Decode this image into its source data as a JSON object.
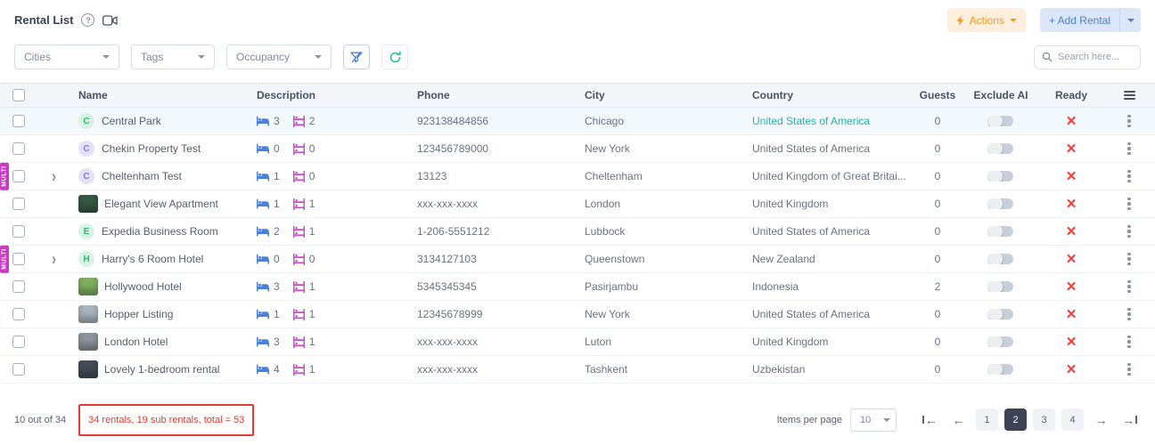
{
  "header": {
    "title": "Rental List",
    "actions_label": "Actions",
    "add_rental_label": "+ Add Rental",
    "accent_orange": "#f29a1e",
    "accent_blue": "#4d80d2"
  },
  "filters": {
    "cities_label": "Cities",
    "tags_label": "Tags",
    "occupancy_label": "Occupancy",
    "search_placeholder": "Search here..."
  },
  "table": {
    "multi_tag_label": "MULTI",
    "expand_glyph": "›",
    "not_ready_glyph": "×",
    "columns": {
      "name": "Name",
      "description": "Description",
      "phone": "Phone",
      "city": "City",
      "country": "Country",
      "guests": "Guests",
      "exclude_ai": "Exclude AI",
      "ready": "Ready"
    },
    "rows": [
      {
        "name": "Central Park",
        "badge": "C",
        "badge_bg": "#d8f3e4",
        "badge_fg": "#2fb57c",
        "thumb": null,
        "multi": false,
        "expandable": false,
        "beds": "3",
        "baths": "2",
        "phone": "923138484856",
        "city": "Chicago",
        "country": "United States of America",
        "country_link": true,
        "guests": "0",
        "exclude_ai": false,
        "ready": false,
        "highlighted": true
      },
      {
        "name": "Chekin Property Test",
        "badge": "C",
        "badge_bg": "#e6e1f9",
        "badge_fg": "#8478d9",
        "thumb": null,
        "multi": false,
        "expandable": false,
        "beds": "0",
        "baths": "0",
        "phone": "123456789000",
        "city": "New York",
        "country": "United States of America",
        "country_link": false,
        "guests": "0",
        "exclude_ai": false,
        "ready": false,
        "highlighted": false
      },
      {
        "name": "Cheltenham Test",
        "badge": "C",
        "badge_bg": "#e6e1f9",
        "badge_fg": "#8478d9",
        "thumb": null,
        "multi": true,
        "expandable": true,
        "beds": "1",
        "baths": "0",
        "phone": "13123",
        "city": "Cheltenham",
        "country": "United Kingdom of Great Britai...",
        "country_link": false,
        "guests": "0",
        "exclude_ai": false,
        "ready": false,
        "highlighted": false
      },
      {
        "name": "Elegant View Apartment",
        "badge": null,
        "badge_bg": null,
        "badge_fg": null,
        "thumb": "#355844",
        "multi": false,
        "expandable": false,
        "beds": "1",
        "baths": "1",
        "phone": "xxx-xxx-xxxx",
        "city": "London",
        "country": "United Kingdom",
        "country_link": false,
        "guests": "0",
        "exclude_ai": false,
        "ready": false,
        "highlighted": false
      },
      {
        "name": "Expedia Business Room",
        "badge": "E",
        "badge_bg": "#d8f3e4",
        "badge_fg": "#2fb57c",
        "thumb": null,
        "multi": false,
        "expandable": false,
        "beds": "2",
        "baths": "1",
        "phone": "1-206-5551212",
        "city": "Lubbock",
        "country": "United States of America",
        "country_link": false,
        "guests": "0",
        "exclude_ai": false,
        "ready": false,
        "highlighted": false
      },
      {
        "name": "Harry's 6 Room Hotel",
        "badge": "H",
        "badge_bg": "#d8f3e4",
        "badge_fg": "#2fb57c",
        "thumb": null,
        "multi": true,
        "expandable": true,
        "beds": "0",
        "baths": "0",
        "phone": "3134127103",
        "city": "Queenstown",
        "country": "New Zealand",
        "country_link": false,
        "guests": "0",
        "exclude_ai": false,
        "ready": false,
        "highlighted": false
      },
      {
        "name": "Hollywood Hotel",
        "badge": null,
        "badge_bg": null,
        "badge_fg": null,
        "thumb": "#7fae5f",
        "multi": false,
        "expandable": false,
        "beds": "3",
        "baths": "1",
        "phone": "5345345345",
        "city": "Pasirjambu",
        "country": "Indonesia",
        "country_link": false,
        "guests": "2",
        "exclude_ai": false,
        "ready": false,
        "highlighted": false
      },
      {
        "name": "Hopper Listing",
        "badge": null,
        "badge_bg": null,
        "badge_fg": null,
        "thumb": "#a9b4bd",
        "multi": false,
        "expandable": false,
        "beds": "1",
        "baths": "1",
        "phone": "12345678999",
        "city": "New York",
        "country": "United States of America",
        "country_link": false,
        "guests": "0",
        "exclude_ai": false,
        "ready": false,
        "highlighted": false
      },
      {
        "name": "London Hotel",
        "badge": null,
        "badge_bg": null,
        "badge_fg": null,
        "thumb": "#8e939b",
        "multi": false,
        "expandable": false,
        "beds": "3",
        "baths": "1",
        "phone": "xxx-xxx-xxxx",
        "city": "Luton",
        "country": "United Kingdom",
        "country_link": false,
        "guests": "0",
        "exclude_ai": false,
        "ready": false,
        "highlighted": false
      },
      {
        "name": "Lovely 1-bedroom rental",
        "badge": null,
        "badge_bg": null,
        "badge_fg": null,
        "thumb": "#454c58",
        "multi": false,
        "expandable": false,
        "beds": "4",
        "baths": "1",
        "phone": "xxx-xxx-xxxx",
        "city": "Tashkent",
        "country": "Uzbekistan",
        "country_link": false,
        "guests": "0",
        "exclude_ai": false,
        "ready": false,
        "highlighted": false
      }
    ]
  },
  "footer": {
    "count_text": "10 out of 34",
    "annotation_text": "34 rentals, 19 sub rentals, total = 53",
    "annotation_color": "#e8392e",
    "items_per_page_label": "Items per page",
    "items_per_page_value": "10",
    "pages": [
      "1",
      "2",
      "3",
      "4"
    ],
    "active_page": "2"
  }
}
